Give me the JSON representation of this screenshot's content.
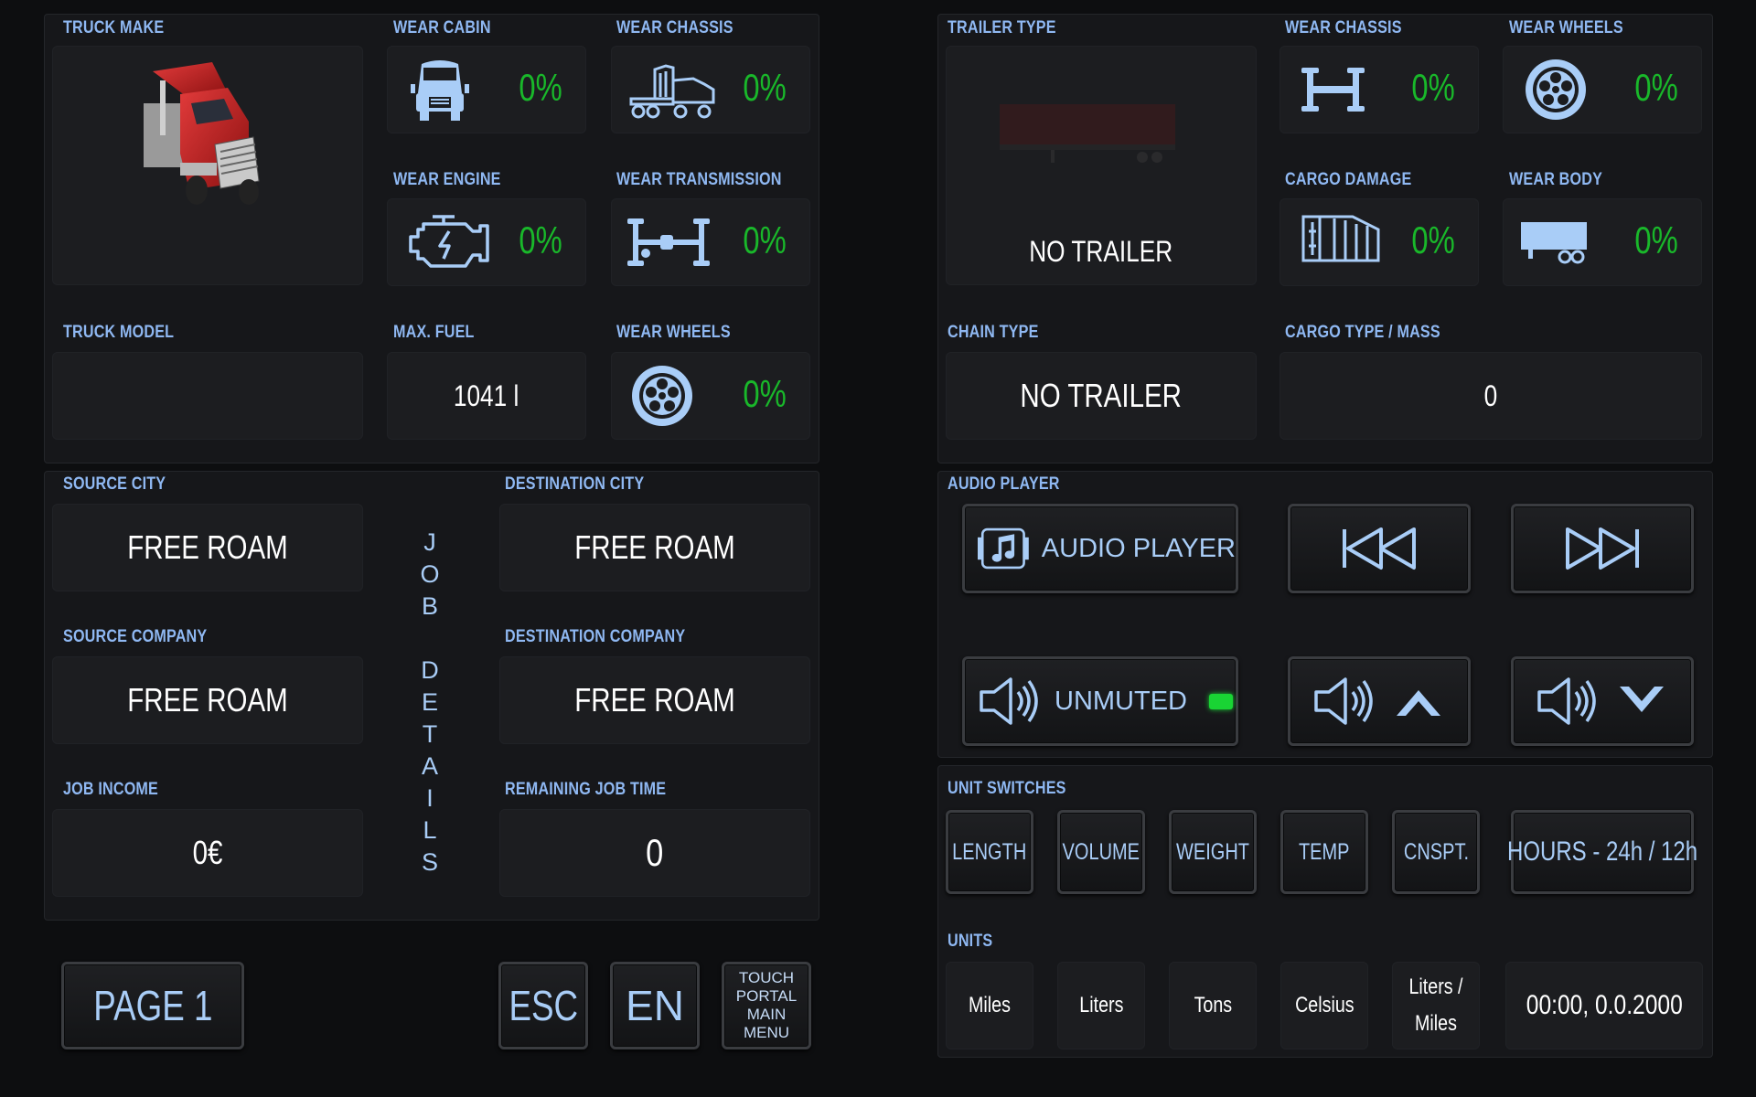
{
  "truck": {
    "make_label": "TRUCK MAKE",
    "wear_cabin_label": "WEAR CABIN",
    "wear_cabin": "0%",
    "wear_chassis_label": "WEAR CHASSIS",
    "wear_chassis": "0%",
    "wear_engine_label": "WEAR ENGINE",
    "wear_engine": "0%",
    "wear_transmission_label": "WEAR TRANSMISSION",
    "wear_transmission": "0%",
    "model_label": "TRUCK MODEL",
    "model": "",
    "max_fuel_label": "MAX. FUEL",
    "max_fuel": "1041 l",
    "wear_wheels_label": "WEAR WHEELS",
    "wear_wheels": "0%"
  },
  "trailer": {
    "type_label": "TRAILER TYPE",
    "type": "NO TRAILER",
    "wear_chassis_label": "WEAR CHASSIS",
    "wear_chassis": "0%",
    "wear_wheels_label": "WEAR WHEELS",
    "wear_wheels": "0%",
    "cargo_damage_label": "CARGO DAMAGE",
    "cargo_damage": "0%",
    "wear_body_label": "WEAR BODY",
    "wear_body": "0%",
    "chain_type_label": "CHAIN TYPE",
    "chain_type": "NO TRAILER",
    "cargo_label": "CARGO TYPE / MASS",
    "cargo": "0"
  },
  "job": {
    "source_city_label": "SOURCE CITY",
    "source_city": "FREE ROAM",
    "dest_city_label": "DESTINATION CITY",
    "dest_city": "FREE ROAM",
    "source_company_label": "SOURCE COMPANY",
    "source_company": "FREE ROAM",
    "dest_company_label": "DESTINATION COMPANY",
    "dest_company": "FREE ROAM",
    "income_label": "JOB INCOME",
    "income": "0€",
    "remaining_label": "REMAINING JOB TIME",
    "remaining": "0",
    "vertical_title": [
      "J",
      "O",
      "B",
      "",
      "D",
      "E",
      "T",
      "A",
      "I",
      "L",
      "S"
    ]
  },
  "audio": {
    "section_label": "AUDIO PLAYER",
    "player_button": "AUDIO PLAYER",
    "mute_button": "UNMUTED",
    "mute_indicator_color": "#19d434"
  },
  "unit_switches": {
    "section_label": "UNIT SWITCHES",
    "length": "LENGTH",
    "volume": "VOLUME",
    "weight": "WEIGHT",
    "temp": "TEMP",
    "cnspt": "CNSPT.",
    "hours": "HOURS - 24h / 12h"
  },
  "units": {
    "section_label": "UNITS",
    "length": "Miles",
    "volume": "Liters",
    "weight": "Tons",
    "temp": "Celsius",
    "cnspt": "Liters / Miles",
    "time": "00:00, 0.0.2000"
  },
  "footer": {
    "page_button": "PAGE 1",
    "esc_button": "ESC",
    "lang_button": "EN",
    "menu_button": "TOUCH PORTAL MAIN MENU"
  },
  "colors": {
    "accent": "#8fb8f2",
    "ok_green": "#19b82a",
    "background": "#0d0e10"
  }
}
